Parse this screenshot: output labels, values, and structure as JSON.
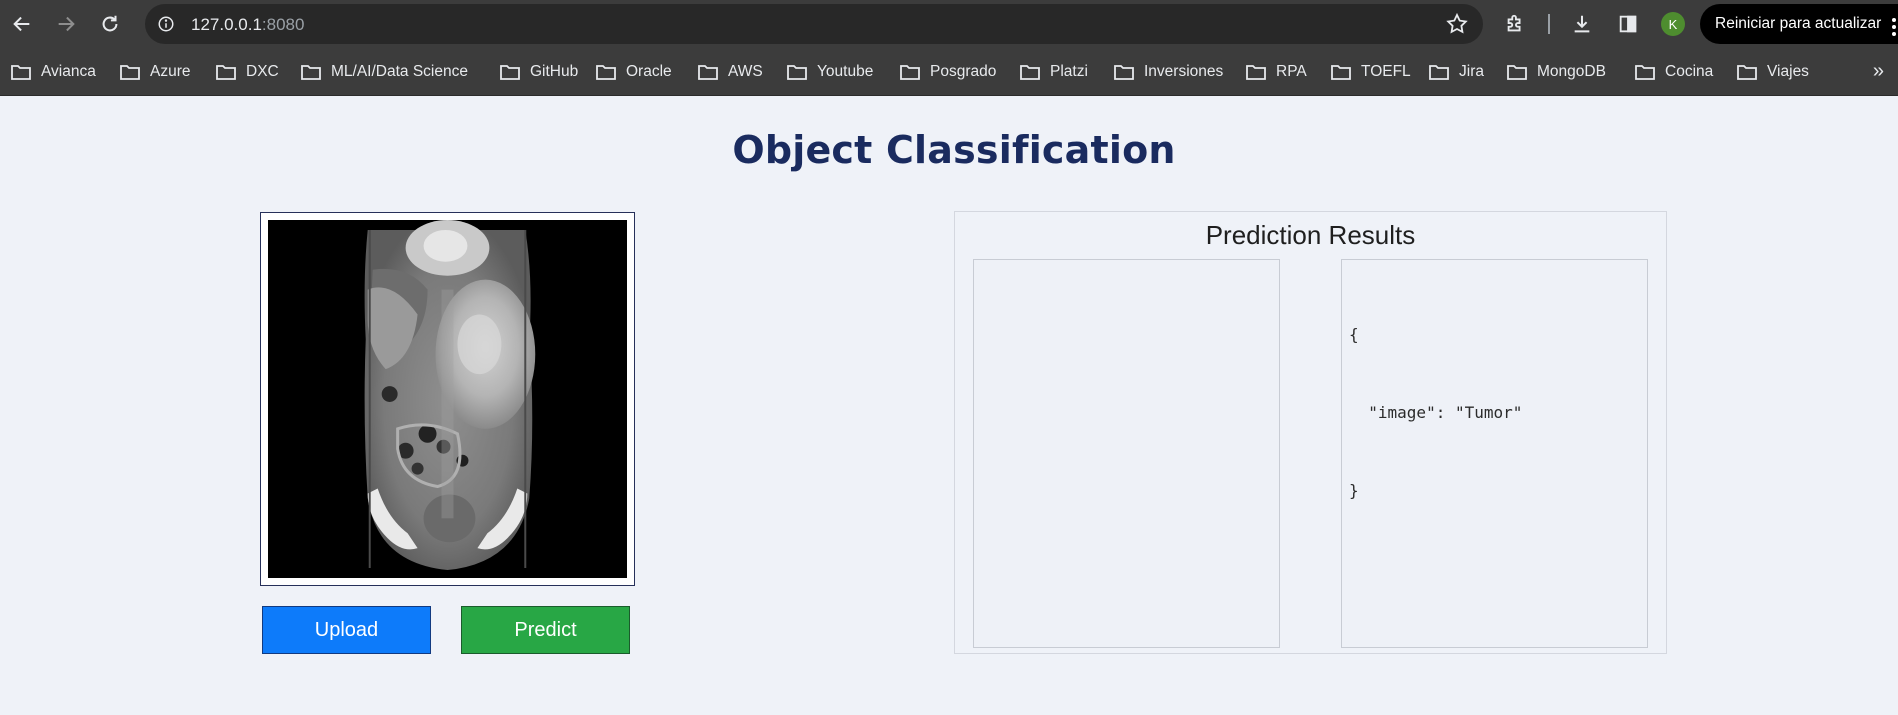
{
  "browser": {
    "url_host": "127.0.0.1",
    "url_port": ":8080",
    "profile_initial": "K",
    "restart_label": "Reiniciar para actualizar",
    "icons": [
      "back-arrow-icon",
      "forward-arrow-icon",
      "reload-icon",
      "site-info-icon",
      "bookmark-star-icon",
      "extensions-icon",
      "download-icon",
      "side-panel-icon",
      "more-vert-icon",
      "folder-icon",
      "chevron-double-right-icon"
    ]
  },
  "bookmarks": [
    {
      "label": "Avianca"
    },
    {
      "label": "Azure"
    },
    {
      "label": "DXC"
    },
    {
      "label": "ML/AI/Data Science"
    },
    {
      "label": "GitHub"
    },
    {
      "label": "Oracle"
    },
    {
      "label": "AWS"
    },
    {
      "label": "Youtube"
    },
    {
      "label": "Posgrado"
    },
    {
      "label": "Platzi"
    },
    {
      "label": "Inversiones"
    },
    {
      "label": "RPA"
    },
    {
      "label": "TOEFL"
    },
    {
      "label": "Jira"
    },
    {
      "label": "MongoDB"
    },
    {
      "label": "Cocina"
    },
    {
      "label": "Viajes"
    }
  ],
  "page": {
    "title": "Object Classification",
    "upload_label": "Upload",
    "predict_label": "Predict",
    "results_title": "Prediction Results",
    "result_json_lines": [
      "{",
      "  \"image\": \"Tumor\"",
      "}"
    ]
  },
  "colors": {
    "page_bg": "#eff2f8",
    "title": "#1a2b5f",
    "upload_button": "#0d7bfa",
    "predict_button": "#28a745",
    "chrome_bg": "#3c3c3c",
    "avatar": "#4e8d2f"
  }
}
